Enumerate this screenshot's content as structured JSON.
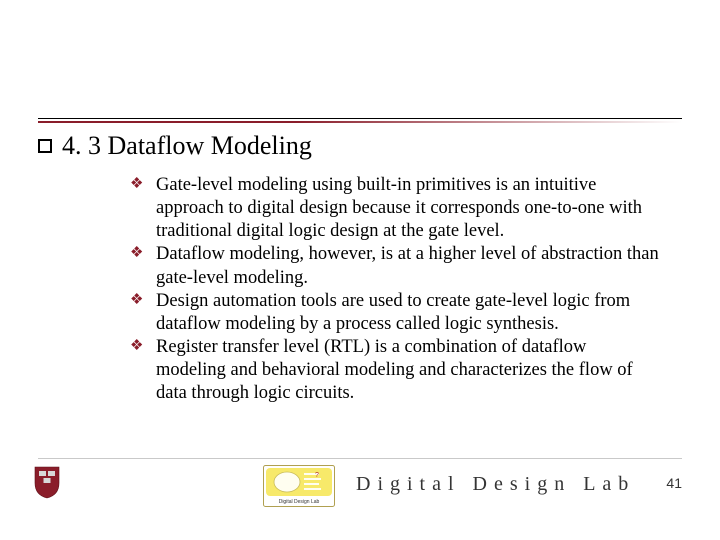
{
  "heading": {
    "text": "4. 3 Dataflow Modeling"
  },
  "bullets": [
    "Gate-level modeling using built-in primitives is an intuitive approach to digital design because it corresponds one-to-one with traditional digital logic design at the gate level.",
    "Dataflow modeling, however, is at a higher level of abstraction than gate-level modeling.",
    "Design automation tools are used to create gate-level logic from dataflow modeling by a process called logic synthesis.",
    "Register transfer level (RTL) is a combination of dataflow modeling and behavioral modeling and characterizes the flow of data through logic circuits."
  ],
  "footer": {
    "title": "Digital Design Lab",
    "page": "41",
    "chip_caption": "Digital Design Lab"
  }
}
